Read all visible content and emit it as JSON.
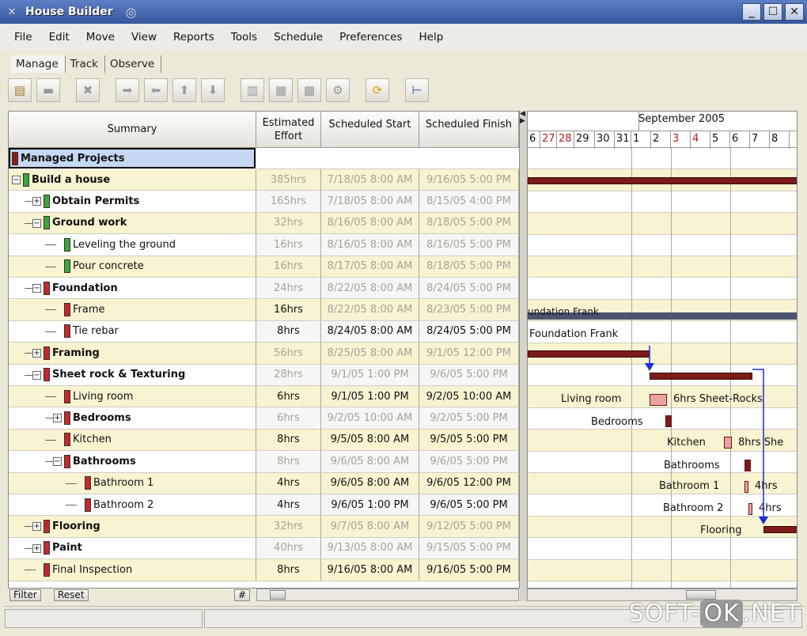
{
  "window": {
    "title": "House Builder"
  },
  "menu": [
    "File",
    "Edit",
    "Move",
    "View",
    "Reports",
    "Tools",
    "Schedule",
    "Preferences",
    "Help"
  ],
  "tabs": [
    "Manage",
    "Track",
    "Observe"
  ],
  "toolbar_icons": [
    "new-icon",
    "open-icon",
    "delete-icon",
    "move-right-icon",
    "move-left-icon",
    "move-up-icon",
    "move-down-icon",
    "copy-icon",
    "paste-icon",
    "cut-icon",
    "link-icon",
    "refresh-icon",
    "tree-icon"
  ],
  "table": {
    "headers": {
      "summary": "Summary",
      "effort": "Estimated Effort",
      "start": "Scheduled Start",
      "finish": "Scheduled Finish"
    },
    "root": "Managed Projects",
    "rows": [
      {
        "name": "Build a house",
        "effort": "385hrs",
        "start": "7/18/05 8:00 AM",
        "finish": "9/16/05 5:00 PM",
        "level": 0,
        "flag": "green",
        "bold": true,
        "dim": true,
        "exp": "-"
      },
      {
        "name": "Obtain Permits",
        "effort": "165hrs",
        "start": "7/18/05 8:00 AM",
        "finish": "8/15/05 4:00 PM",
        "level": 1,
        "flag": "green",
        "bold": true,
        "dim": true,
        "exp": "+"
      },
      {
        "name": "Ground work",
        "effort": "32hrs",
        "start": "8/16/05 8:00 AM",
        "finish": "8/18/05 5:00 PM",
        "level": 1,
        "flag": "green",
        "bold": true,
        "dim": true,
        "exp": "-"
      },
      {
        "name": "Leveling the ground",
        "effort": "16hrs",
        "start": "8/16/05 8:00 AM",
        "finish": "8/16/05 5:00 PM",
        "level": 2,
        "flag": "green",
        "bold": false,
        "dim": true,
        "exp": ""
      },
      {
        "name": "Pour concrete",
        "effort": "16hrs",
        "start": "8/17/05 8:00 AM",
        "finish": "8/18/05 5:00 PM",
        "level": 2,
        "flag": "green",
        "bold": false,
        "dim": true,
        "exp": ""
      },
      {
        "name": "Foundation",
        "effort": "24hrs",
        "start": "8/22/05 8:00 AM",
        "finish": "8/24/05 5:00 PM",
        "level": 1,
        "flag": "red",
        "bold": true,
        "dim": true,
        "exp": "-"
      },
      {
        "name": "Frame",
        "effort": "16hrs",
        "start": "8/22/05 8:00 AM",
        "finish": "8/23/05 5:00 PM",
        "level": 2,
        "flag": "red",
        "bold": false,
        "dim": false,
        "dimdates": true,
        "exp": ""
      },
      {
        "name": "Tie rebar",
        "effort": "8hrs",
        "start": "8/24/05 8:00 AM",
        "finish": "8/24/05 5:00 PM",
        "level": 2,
        "flag": "red",
        "bold": false,
        "dim": false,
        "exp": ""
      },
      {
        "name": "Framing",
        "effort": "56hrs",
        "start": "8/25/05 8:00 AM",
        "finish": "9/1/05 12:00 PM",
        "level": 1,
        "flag": "red",
        "bold": true,
        "dim": true,
        "exp": "+"
      },
      {
        "name": "Sheet rock & Texturing",
        "effort": "28hrs",
        "start": "9/1/05 1:00 PM",
        "finish": "9/6/05 5:00 PM",
        "level": 1,
        "flag": "red",
        "bold": true,
        "dim": true,
        "exp": "-"
      },
      {
        "name": "Living room",
        "effort": "6hrs",
        "start": "9/1/05 1:00 PM",
        "finish": "9/2/05 10:00 AM",
        "level": 2,
        "flag": "red",
        "bold": false,
        "dim": false,
        "exp": ""
      },
      {
        "name": "Bedrooms",
        "effort": "6hrs",
        "start": "9/2/05 10:00 AM",
        "finish": "9/2/05 5:00 PM",
        "level": 2,
        "flag": "red",
        "bold": true,
        "dim": true,
        "exp": "+"
      },
      {
        "name": "Kitchen",
        "effort": "8hrs",
        "start": "9/5/05 8:00 AM",
        "finish": "9/5/05 5:00 PM",
        "level": 2,
        "flag": "red",
        "bold": false,
        "dim": false,
        "exp": ""
      },
      {
        "name": "Bathrooms",
        "effort": "8hrs",
        "start": "9/6/05 8:00 AM",
        "finish": "9/6/05 5:00 PM",
        "level": 2,
        "flag": "red",
        "bold": true,
        "dim": true,
        "exp": "-"
      },
      {
        "name": "Bathroom 1",
        "effort": "4hrs",
        "start": "9/6/05 8:00 AM",
        "finish": "9/6/05 12:00 PM",
        "level": 3,
        "flag": "red",
        "bold": false,
        "dim": false,
        "exp": ""
      },
      {
        "name": "Bathroom 2",
        "effort": "4hrs",
        "start": "9/6/05 1:00 PM",
        "finish": "9/6/05 5:00 PM",
        "level": 3,
        "flag": "red",
        "bold": false,
        "dim": false,
        "exp": ""
      },
      {
        "name": "Flooring",
        "effort": "32hrs",
        "start": "9/7/05 8:00 AM",
        "finish": "9/12/05 5:00 PM",
        "level": 1,
        "flag": "red",
        "bold": true,
        "dim": true,
        "exp": "+"
      },
      {
        "name": "Paint",
        "effort": "40hrs",
        "start": "9/13/05 8:00 AM",
        "finish": "9/15/05 5:00 PM",
        "level": 1,
        "flag": "red",
        "bold": true,
        "dim": true,
        "exp": "+"
      },
      {
        "name": "Final Inspection",
        "effort": "8hrs",
        "start": "9/16/05 8:00 AM",
        "finish": "9/16/05 5:00 PM",
        "level": 1,
        "flag": "red",
        "bold": false,
        "dim": false,
        "exp": ""
      }
    ]
  },
  "gantt": {
    "month": "September 2005",
    "days": [
      {
        "d": "6",
        "red": false
      },
      {
        "d": "27",
        "red": true
      },
      {
        "d": "28",
        "red": true
      },
      {
        "d": "29",
        "red": false
      },
      {
        "d": "30",
        "red": false
      },
      {
        "d": "31",
        "red": false
      },
      {
        "d": "1",
        "red": false
      },
      {
        "d": "2",
        "red": false
      },
      {
        "d": "3",
        "red": true
      },
      {
        "d": "4",
        "red": true
      },
      {
        "d": "5",
        "red": false
      },
      {
        "d": "6",
        "red": false
      },
      {
        "d": "7",
        "red": false
      },
      {
        "d": "8",
        "red": false
      }
    ],
    "labels": {
      "foundation_top": "undation Frank",
      "foundation": "Foundation Frank",
      "living_room": "Living room",
      "living_room_note": "6hrs Sheet-Rocks",
      "bedrooms": "Bedrooms",
      "kitchen": "Kitchen",
      "kitchen_note": "8hrs She",
      "bathrooms": "Bathrooms",
      "bathroom1": "Bathroom 1",
      "bathroom1_note": "4hrs",
      "bathroom2": "Bathroom 2",
      "bathroom2_note": "4hrs",
      "flooring": "Flooring"
    }
  },
  "bottom": {
    "filter": "Filter",
    "reset": "Reset",
    "hash": "#"
  },
  "watermark": {
    "pre": "SOFT-",
    "ok": "OK",
    "post": ".NET"
  },
  "colors": {
    "title_bar": "#36569e",
    "row_alt": "#f8f3d0",
    "selected": "#c5d7f2",
    "bar": "#7c1b1b",
    "dependency": "#1a2fd6"
  }
}
